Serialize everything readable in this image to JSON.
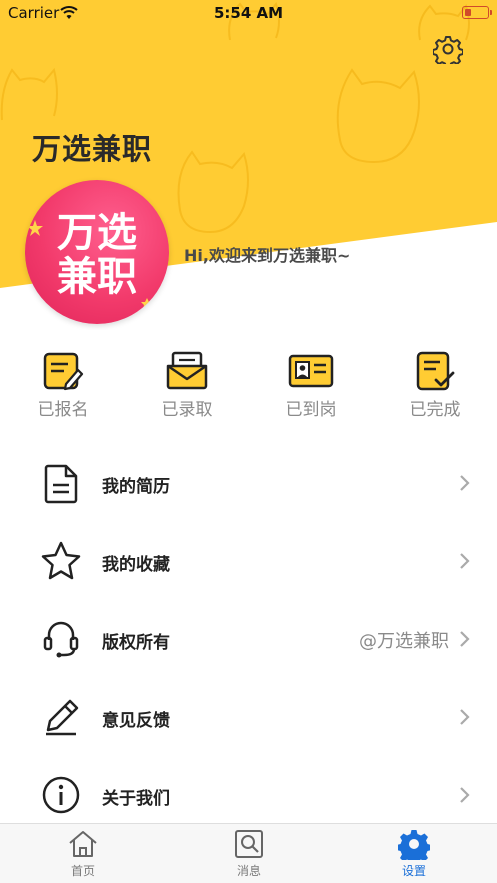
{
  "status_bar": {
    "carrier": "Carrier",
    "time": "5:54 AM"
  },
  "header": {
    "app_title": "万选兼职",
    "welcome": "Hi,欢迎来到万选兼职~",
    "logo_text": "万选兼职",
    "colors": {
      "yellow": "#ffcc33",
      "logo_pink": "#f23a6b"
    }
  },
  "status_items": [
    {
      "label": "已报名",
      "icon": "signed-up-icon"
    },
    {
      "label": "已录取",
      "icon": "admitted-icon"
    },
    {
      "label": "已到岗",
      "icon": "on-duty-icon"
    },
    {
      "label": "已完成",
      "icon": "completed-icon"
    }
  ],
  "menu": [
    {
      "label": "我的简历",
      "value": "",
      "icon": "resume-icon"
    },
    {
      "label": "我的收藏",
      "value": "",
      "icon": "star-icon"
    },
    {
      "label": "版权所有",
      "value": "@万选兼职",
      "icon": "headset-icon"
    },
    {
      "label": "意见反馈",
      "value": "",
      "icon": "pencil-icon"
    },
    {
      "label": "关于我们",
      "value": "",
      "icon": "info-icon"
    }
  ],
  "tabbar": {
    "tabs": [
      {
        "label": "首页",
        "icon": "home-icon",
        "active": false
      },
      {
        "label": "消息",
        "icon": "message-icon",
        "active": false
      },
      {
        "label": "设置",
        "icon": "settings-icon",
        "active": true
      }
    ],
    "active_color": "#1a6fd8"
  }
}
